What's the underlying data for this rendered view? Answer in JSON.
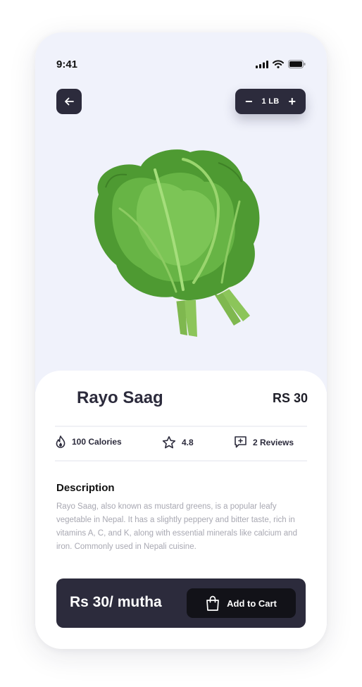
{
  "status_bar": {
    "time": "9:41"
  },
  "header": {
    "quantity": "1 LB",
    "minus": "−",
    "plus": "+"
  },
  "product": {
    "name": "Rayo Saag",
    "price": "RS 30"
  },
  "stats": {
    "calories": "100 Calories",
    "rating": "4.8",
    "reviews": "2 Reviews"
  },
  "description": {
    "title": "Description",
    "text": "Rayo Saag, also known as mustard greens, is a popular leafy vegetable in Nepal. It has a slightly peppery and bitter taste, rich in vitamins A, C, and K, along with essential minerals like calcium and iron. Commonly used in Nepali cuisine."
  },
  "cart": {
    "price": "Rs 30/ mutha",
    "button_label": "Add to Cart"
  },
  "colors": {
    "hero_background": "#f0f2fb",
    "dark": "#2c2b3c",
    "button_dark": "#121218",
    "muted_text": "#a8a8b2"
  },
  "icons": [
    "signal-icon",
    "wifi-icon",
    "battery-icon",
    "back-arrow-icon",
    "flame-icon",
    "star-icon",
    "review-icon",
    "shopping-bag-icon"
  ]
}
